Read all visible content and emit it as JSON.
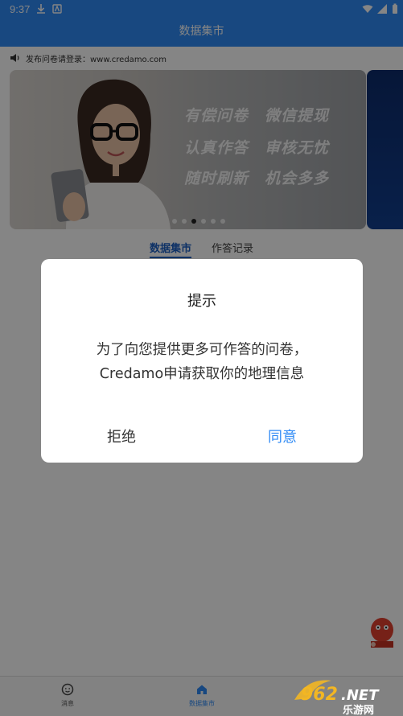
{
  "status_bar": {
    "time": "9:37"
  },
  "header": {
    "title": "数据集市"
  },
  "notice": {
    "text": "发布问卷请登录：www.credamo.com"
  },
  "banner": {
    "slogans": [
      "有偿问卷",
      "微信提现",
      "认真作答",
      "审核无忧",
      "随时刷新",
      "机会多多"
    ],
    "page_count": 6,
    "active_page": 3
  },
  "tabs": [
    {
      "label": "数据集市",
      "active": true
    },
    {
      "label": "作答记录",
      "active": false
    }
  ],
  "bottom_nav": [
    {
      "label": "消息",
      "icon": "smiley-icon",
      "active": false
    },
    {
      "label": "数据集市",
      "icon": "home-icon",
      "active": true
    }
  ],
  "dialog": {
    "title": "提示",
    "message_line1": "为了向您提供更多可作答的问卷，",
    "message_line2": "Credamo申请获取你的地理信息",
    "deny_label": "拒绝",
    "agree_label": "同意"
  },
  "watermark": {
    "text": "962.NET",
    "subtext": "乐游网"
  },
  "colors": {
    "accent": "#2f8af5",
    "tab_active": "#1e60c4",
    "scrim": "rgba(0,0,0,0.48)"
  }
}
